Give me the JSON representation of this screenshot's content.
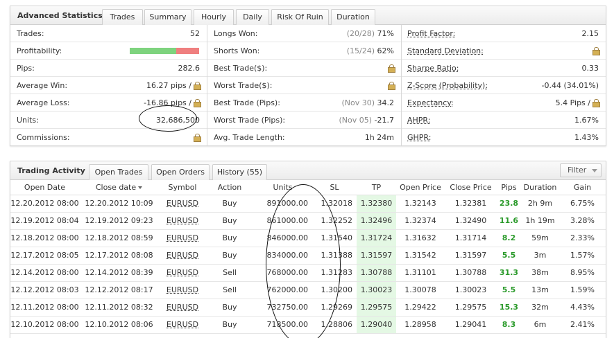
{
  "stats_panel": {
    "title": "Advanced Statistics",
    "tabs": [
      "Trades",
      "Summary",
      "Hourly",
      "Daily",
      "Risk Of Ruin",
      "Duration"
    ],
    "col1": [
      {
        "label": "Trades:",
        "value": "52"
      },
      {
        "label": "Profitability:",
        "value": ""
      },
      {
        "label": "Pips:",
        "value": "282.6"
      },
      {
        "label": "Average Win:",
        "value": "16.27 pips /"
      },
      {
        "label": "Average Loss:",
        "value": "-16.86 pips /"
      },
      {
        "label": "Units:",
        "value": "32,686,500"
      },
      {
        "label": "Commissions:",
        "value": ""
      }
    ],
    "col2": [
      {
        "label": "Longs Won:",
        "muted": "(20/28)",
        "value": "71%"
      },
      {
        "label": "Shorts Won:",
        "muted": "(15/24)",
        "value": "62%"
      },
      {
        "label": "Best Trade($):",
        "muted": "",
        "value": ""
      },
      {
        "label": "Worst Trade($):",
        "muted": "",
        "value": ""
      },
      {
        "label": "Best Trade (Pips):",
        "muted": "(Nov 30)",
        "value": "34.2"
      },
      {
        "label": "Worst Trade (Pips):",
        "muted": "(Nov 05)",
        "value": "-21.7"
      },
      {
        "label": "Avg. Trade Length:",
        "muted": "",
        "value": "1h 24m"
      }
    ],
    "col3": [
      {
        "label": "Profit Factor:",
        "value": "2.15"
      },
      {
        "label": "Standard Deviation:",
        "value": ""
      },
      {
        "label": "Sharpe Ratio:",
        "value": "0.33"
      },
      {
        "label": "Z-Score (Probability):",
        "value": "-0.44 (34.01%)"
      },
      {
        "label": "Expectancy:",
        "value": "5.4 Pips /"
      },
      {
        "label": "AHPR:",
        "value": "1.67%"
      },
      {
        "label": "GHPR:",
        "value": "1.43%"
      }
    ],
    "profitability_win_fraction": 0.67,
    "colors": {
      "win": "#7ed37e",
      "loss": "#ef7f7f",
      "pips_positive": "#2a9a2a",
      "tp_cell": "#e4f8e4"
    },
    "icon": "lock-icon"
  },
  "activity_panel": {
    "title": "Trading Activity",
    "tabs": [
      "Open Trades",
      "Open Orders",
      "History (55)"
    ],
    "filter_label": "Filter",
    "columns": [
      "Open Date",
      "Close date",
      "Symbol",
      "Action",
      "Units",
      "SL",
      "TP",
      "Open Price",
      "Close Price",
      "Pips",
      "Duration",
      "Gain"
    ],
    "rows": [
      [
        "12.20.2012 08:00",
        "12.20.2012 10:09",
        "EURUSD",
        "Buy",
        "891000.00",
        "1.32018",
        "1.32380",
        "1.32143",
        "1.32381",
        "23.8",
        "2h 9m",
        "6.75%"
      ],
      [
        "12.19.2012 08:04",
        "12.19.2012 09:23",
        "EURUSD",
        "Buy",
        "861000.00",
        "1.32252",
        "1.32496",
        "1.32374",
        "1.32490",
        "11.6",
        "1h 19m",
        "3.28%"
      ],
      [
        "12.18.2012 08:00",
        "12.18.2012 08:59",
        "EURUSD",
        "Buy",
        "846000.00",
        "1.31540",
        "1.31724",
        "1.31632",
        "1.31714",
        "8.2",
        "59m",
        "2.33%"
      ],
      [
        "12.17.2012 08:05",
        "12.17.2012 08:08",
        "EURUSD",
        "Buy",
        "834000.00",
        "1.31388",
        "1.31597",
        "1.31542",
        "1.31597",
        "5.5",
        "3m",
        "1.57%"
      ],
      [
        "12.14.2012 08:00",
        "12.14.2012 08:39",
        "EURUSD",
        "Sell",
        "768000.00",
        "1.31283",
        "1.30788",
        "1.31101",
        "1.30788",
        "31.3",
        "38m",
        "8.95%"
      ],
      [
        "12.12.2012 08:03",
        "12.12.2012 08:17",
        "EURUSD",
        "Sell",
        "762000.00",
        "1.30200",
        "1.30023",
        "1.30078",
        "1.30023",
        "5.5",
        "13m",
        "1.59%"
      ],
      [
        "12.11.2012 08:00",
        "12.11.2012 08:32",
        "EURUSD",
        "Buy",
        "732750.00",
        "1.29269",
        "1.29575",
        "1.29422",
        "1.29575",
        "15.3",
        "32m",
        "4.43%"
      ],
      [
        "12.10.2012 08:00",
        "12.10.2012 08:06",
        "EURUSD",
        "Buy",
        "718500.00",
        "1.28806",
        "1.29040",
        "1.28958",
        "1.29041",
        "8.3",
        "6m",
        "2.41%"
      ]
    ]
  }
}
